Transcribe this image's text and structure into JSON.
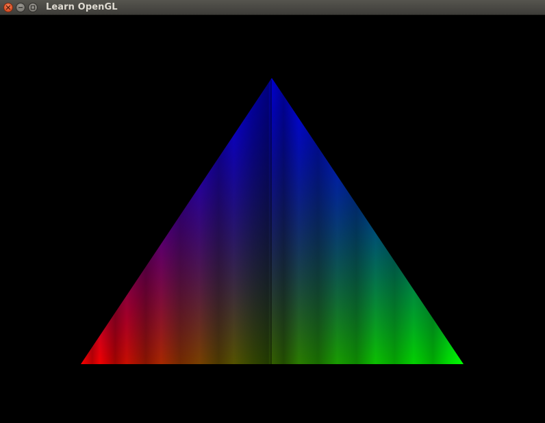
{
  "window": {
    "title": "Learn OpenGL",
    "controls": [
      {
        "name": "close",
        "icon": "close-icon",
        "color": "#e2552a"
      },
      {
        "name": "minimize",
        "icon": "minimize-icon",
        "color": "#7b7973"
      },
      {
        "name": "maximize",
        "icon": "maximize-icon",
        "color": "#7b7973"
      }
    ]
  },
  "scene": {
    "background": "#000000",
    "shape": "triangle",
    "vertex_colors": {
      "top": "#0000ff",
      "bottom_left": "#ff0000",
      "bottom_right": "#00ff00"
    }
  }
}
